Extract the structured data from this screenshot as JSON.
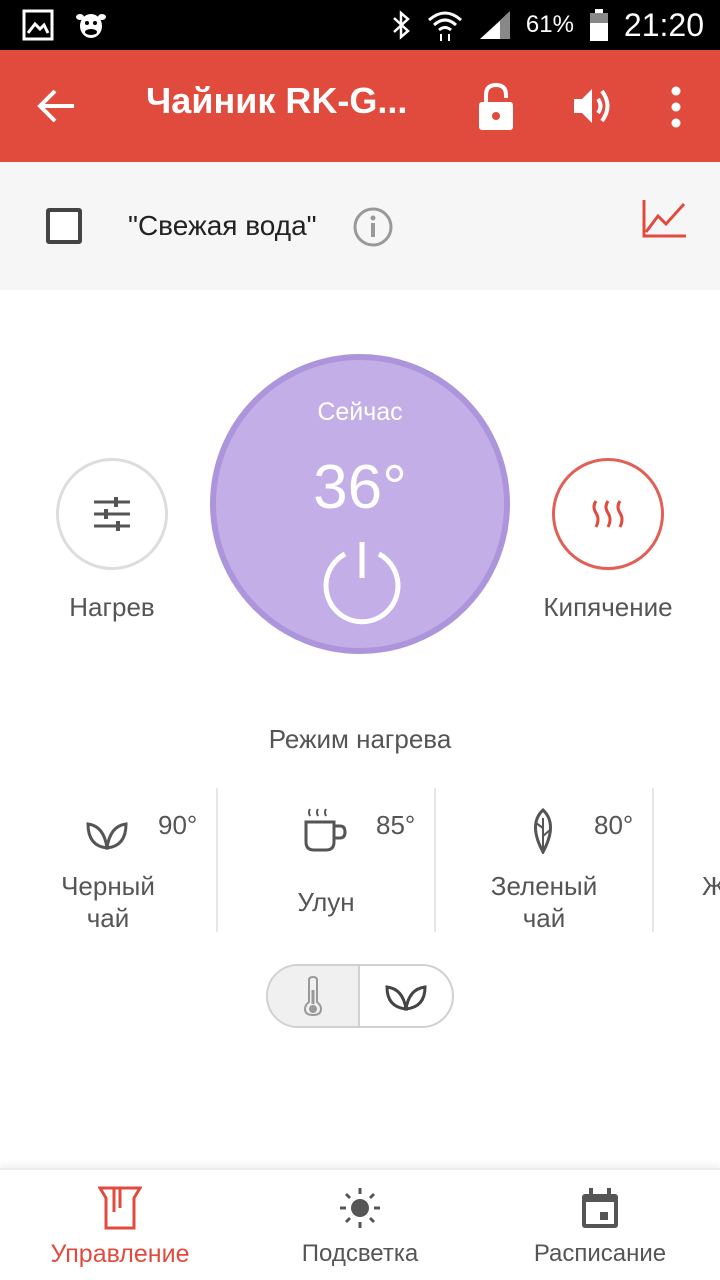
{
  "status_bar": {
    "battery": "61%",
    "time": "21:20",
    "icons": [
      "gallery-icon",
      "cow-icon",
      "bluetooth-icon",
      "wifi-icon",
      "signal-icon",
      "battery-icon"
    ]
  },
  "app_bar": {
    "title": "Чайник RK-G...",
    "color": "#e04b3e",
    "icons": [
      "back-arrow-icon",
      "lock-icon",
      "volume-icon",
      "more-vert-icon"
    ]
  },
  "fresh_water": {
    "label": "\"Свежая вода\"",
    "checked": false
  },
  "controls": {
    "heat_label": "Нагрев",
    "boil_label": "Кипячение",
    "now_label": "Сейчас",
    "current_temp": "36°",
    "circle_color": "#c4aee8"
  },
  "heating_mode": {
    "title": "Режим нагрева",
    "modes": [
      {
        "name_line1": "Черный",
        "name_line2": "чай",
        "temp": "90°",
        "icon": "leaves-icon"
      },
      {
        "name_line1": "Улун",
        "name_line2": "",
        "temp": "85°",
        "icon": "cup-icon"
      },
      {
        "name_line1": "Зеленый",
        "name_line2": "чай",
        "temp": "80°",
        "icon": "leaf-icon"
      },
      {
        "name_line1": "Ж",
        "name_line2": "",
        "temp": "",
        "icon": ""
      }
    ]
  },
  "toggle": {
    "icons": [
      "thermometer-icon",
      "leaves-icon"
    ]
  },
  "bottom_nav": {
    "items": [
      {
        "label": "Управление",
        "icon": "kettle-icon",
        "active": true
      },
      {
        "label": "Подсветка",
        "icon": "sun-icon",
        "active": false
      },
      {
        "label": "Расписание",
        "icon": "calendar-icon",
        "active": false
      }
    ]
  }
}
